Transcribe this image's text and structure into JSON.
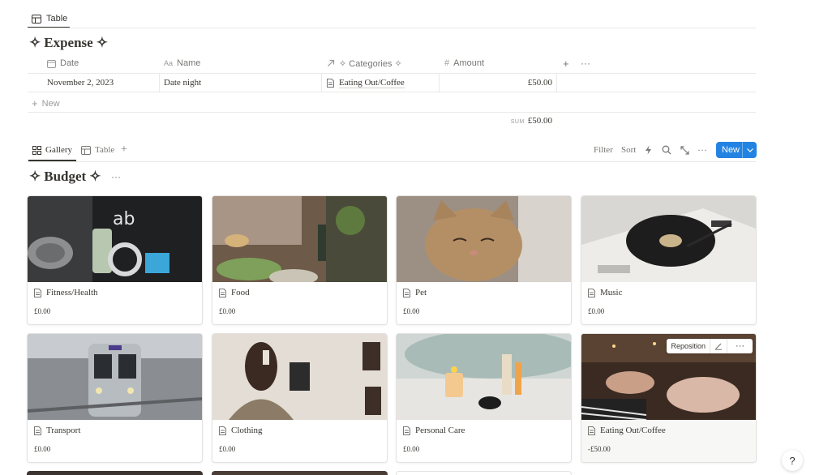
{
  "top_tab": {
    "label": "Table"
  },
  "expense": {
    "title": "Expense",
    "columns": [
      {
        "icon": "calendar-icon",
        "label": "Date"
      },
      {
        "icon": "text-property-icon",
        "label": "Name"
      },
      {
        "icon": "relation-arrow-icon",
        "label": "✧ Categories ✧"
      },
      {
        "icon": "number-hash-icon",
        "label": "Amount"
      }
    ],
    "rows": [
      {
        "date": "November 2, 2023",
        "name": "Date night",
        "category": "Eating Out/Coffee",
        "amount": "£50.00"
      }
    ],
    "new_label": "New",
    "sum_label": "SUM",
    "sum_value": "£50.00"
  },
  "toolbar": {
    "views": [
      {
        "label": "Gallery",
        "active": true
      },
      {
        "label": "Table",
        "active": false
      }
    ],
    "filter": "Filter",
    "sort": "Sort",
    "new": "New"
  },
  "budget": {
    "title": "Budget",
    "cards": [
      {
        "title": "Fitness/Health",
        "amount": "£0.00"
      },
      {
        "title": "Food",
        "amount": "£0.00"
      },
      {
        "title": "Pet",
        "amount": "£0.00"
      },
      {
        "title": "Music",
        "amount": "£0.00"
      },
      {
        "title": "Transport",
        "amount": "£0.00"
      },
      {
        "title": "Clothing",
        "amount": "£0.00"
      },
      {
        "title": "Personal Care",
        "amount": "£0.00"
      },
      {
        "title": "Eating Out/Coffee",
        "amount": "-£50.00"
      }
    ],
    "reposition": "Reposition"
  },
  "help": "?"
}
